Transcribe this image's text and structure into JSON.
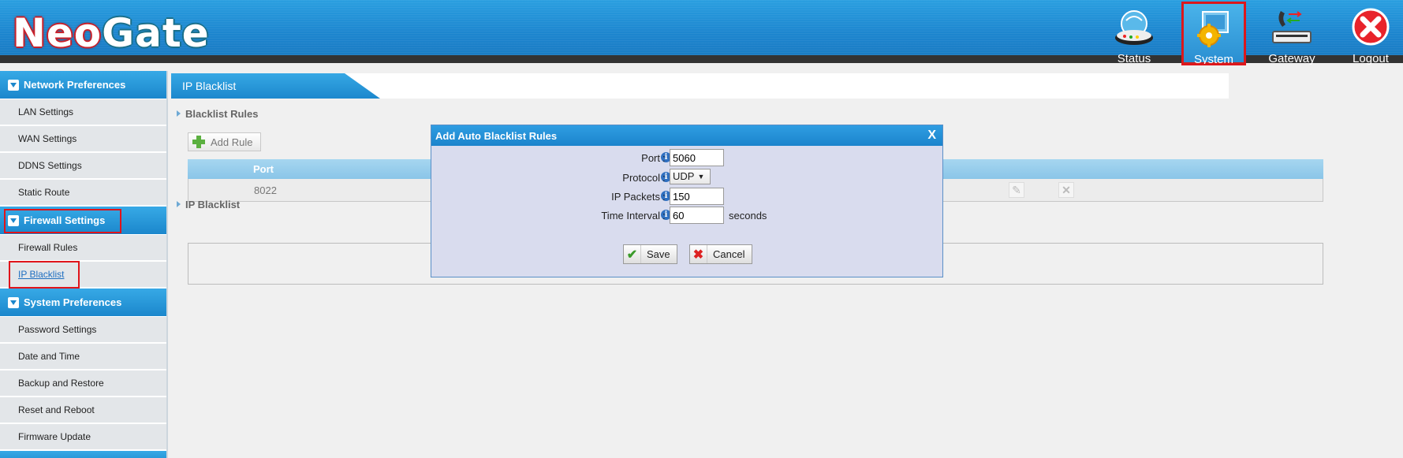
{
  "header": {
    "logo": {
      "part1": "Neo",
      "part2": "Gate"
    },
    "nav": [
      {
        "label": "Status",
        "icon": "status-icon"
      },
      {
        "label": "System",
        "icon": "system-gear-icon",
        "active": true
      },
      {
        "label": "Gateway",
        "icon": "gateway-phone-icon"
      },
      {
        "label": "Logout",
        "icon": "logout-x-icon"
      }
    ]
  },
  "sidebar": {
    "sections": [
      {
        "title": "Network Preferences",
        "items": [
          "LAN Settings",
          "WAN Settings",
          "DDNS Settings",
          "Static Route"
        ]
      },
      {
        "title": "Firewall Settings",
        "items": [
          "Firewall Rules",
          "IP Blacklist"
        ]
      },
      {
        "title": "System Preferences",
        "items": [
          "Password Settings",
          "Date and Time",
          "Backup and Restore",
          "Reset and Reboot",
          "Firmware Update"
        ]
      }
    ],
    "selected_item": "IP Blacklist"
  },
  "main": {
    "tab": "IP Blacklist",
    "blacklist_rules_title": "Blacklist Rules",
    "add_rule_label": "Add Rule",
    "table": {
      "headers": [
        "Port"
      ],
      "rows": [
        {
          "port": "8022"
        }
      ]
    },
    "ip_blacklist_title": "IP Blacklist"
  },
  "dialog": {
    "title": "Add Auto Blacklist Rules",
    "close_label": "X",
    "fields": {
      "port": {
        "label": "Port",
        "value": "5060"
      },
      "protocol": {
        "label": "Protocol",
        "value": "UDP"
      },
      "ip_packets": {
        "label": "IP Packets",
        "value": "150"
      },
      "time_interval": {
        "label": "Time Interval",
        "value": "60",
        "unit": "seconds"
      }
    },
    "save_label": "Save",
    "cancel_label": "Cancel"
  },
  "colors": {
    "header_blue": "#1d86cf",
    "highlight_red": "#e0141b",
    "dialog_bg": "#d9dcee"
  }
}
